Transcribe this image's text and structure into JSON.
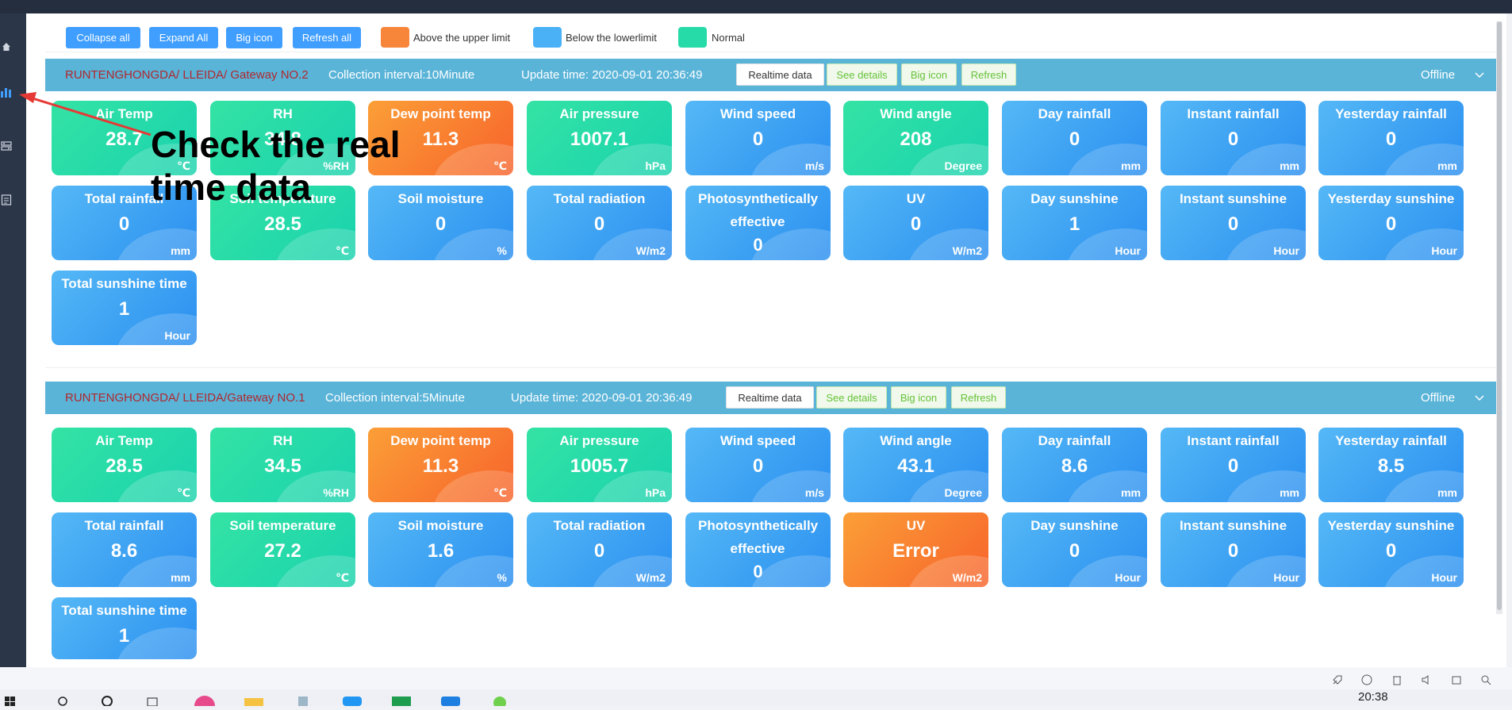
{
  "toolbar": {
    "collapse_all": "Collapse all",
    "expand_all": "Expand All",
    "big_icon": "Big icon",
    "refresh_all": "Refresh all",
    "legend": [
      {
        "label": "Above the upper limit",
        "color": "#f7853a"
      },
      {
        "label": "Below the lowerlimit",
        "color": "#4ab1f7"
      },
      {
        "label": "Normal",
        "color": "#26dba8"
      }
    ]
  },
  "gateways": [
    {
      "name": "RUNTENGHONGDA/ LLEIDA/ Gateway NO.2",
      "interval": "Collection interval:10Minute",
      "update": "Update time: 2020-09-01 20:36:49",
      "buttons": {
        "realtime": "Realtime data",
        "details": "See details",
        "big_icon": "Big icon",
        "refresh": "Refresh"
      },
      "status": "Offline",
      "cards": [
        {
          "title": "Air Temp",
          "value": "28.7",
          "unit": "℃",
          "color": "green"
        },
        {
          "title": "RH",
          "value": "34.8",
          "unit": "%RH",
          "color": "green"
        },
        {
          "title": "Dew point temp",
          "value": "11.3",
          "unit": "℃",
          "color": "orange"
        },
        {
          "title": "Air pressure",
          "value": "1007.1",
          "unit": "hPa",
          "color": "green"
        },
        {
          "title": "Wind speed",
          "value": "0",
          "unit": "m/s",
          "color": "blue"
        },
        {
          "title": "Wind angle",
          "value": "208",
          "unit": "Degree",
          "color": "green"
        },
        {
          "title": "Day rainfall",
          "value": "0",
          "unit": "mm",
          "color": "blue"
        },
        {
          "title": "Instant rainfall",
          "value": "0",
          "unit": "mm",
          "color": "blue"
        },
        {
          "title": "Yesterday rainfall",
          "value": "0",
          "unit": "mm",
          "color": "blue"
        },
        {
          "title": "Total rainfall",
          "value": "0",
          "unit": "mm",
          "color": "blue"
        },
        {
          "title": "Soil temperature",
          "value": "28.5",
          "unit": "℃",
          "color": "green"
        },
        {
          "title": "Soil moisture",
          "value": "0",
          "unit": "%",
          "color": "blue"
        },
        {
          "title": "Total radiation",
          "value": "0",
          "unit": "W/m2",
          "color": "blue"
        },
        {
          "title": "Photosynthetically effective",
          "value": "0",
          "unit": "",
          "color": "blue",
          "two_line": true
        },
        {
          "title": "UV",
          "value": "0",
          "unit": "W/m2",
          "color": "blue"
        },
        {
          "title": "Day sunshine",
          "value": "1",
          "unit": "Hour",
          "color": "blue"
        },
        {
          "title": "Instant sunshine",
          "value": "0",
          "unit": "Hour",
          "color": "blue"
        },
        {
          "title": "Yesterday sunshine",
          "value": "0",
          "unit": "Hour",
          "color": "blue"
        },
        {
          "title": "Total sunshine time",
          "value": "1",
          "unit": "Hour",
          "color": "blue"
        }
      ]
    },
    {
      "name": "RUNTENGHONGDA/ LLEIDA/Gateway NO.1",
      "interval": "Collection interval:5Minute",
      "update": "Update time: 2020-09-01 20:36:49",
      "buttons": {
        "realtime": "Realtime data",
        "details": "See details",
        "big_icon": "Big icon",
        "refresh": "Refresh"
      },
      "status": "Offline",
      "cards": [
        {
          "title": "Air Temp",
          "value": "28.5",
          "unit": "℃",
          "color": "green"
        },
        {
          "title": "RH",
          "value": "34.5",
          "unit": "%RH",
          "color": "green"
        },
        {
          "title": "Dew point temp",
          "value": "11.3",
          "unit": "℃",
          "color": "orange"
        },
        {
          "title": "Air pressure",
          "value": "1005.7",
          "unit": "hPa",
          "color": "green"
        },
        {
          "title": "Wind speed",
          "value": "0",
          "unit": "m/s",
          "color": "blue"
        },
        {
          "title": "Wind angle",
          "value": "43.1",
          "unit": "Degree",
          "color": "blue"
        },
        {
          "title": "Day rainfall",
          "value": "8.6",
          "unit": "mm",
          "color": "blue"
        },
        {
          "title": "Instant rainfall",
          "value": "0",
          "unit": "mm",
          "color": "blue"
        },
        {
          "title": "Yesterday rainfall",
          "value": "8.5",
          "unit": "mm",
          "color": "blue"
        },
        {
          "title": "Total rainfall",
          "value": "8.6",
          "unit": "mm",
          "color": "blue"
        },
        {
          "title": "Soil temperature",
          "value": "27.2",
          "unit": "℃",
          "color": "green"
        },
        {
          "title": "Soil moisture",
          "value": "1.6",
          "unit": "%",
          "color": "blue"
        },
        {
          "title": "Total radiation",
          "value": "0",
          "unit": "W/m2",
          "color": "blue"
        },
        {
          "title": "Photosynthetically effective",
          "value": "0",
          "unit": "",
          "color": "blue",
          "two_line": true
        },
        {
          "title": "UV",
          "value": "Error",
          "unit": "W/m2",
          "color": "orange"
        },
        {
          "title": "Day sunshine",
          "value": "0",
          "unit": "Hour",
          "color": "blue"
        },
        {
          "title": "Instant sunshine",
          "value": "0",
          "unit": "Hour",
          "color": "blue"
        },
        {
          "title": "Yesterday sunshine",
          "value": "0",
          "unit": "Hour",
          "color": "blue"
        },
        {
          "title": "Total sunshine time",
          "value": "1",
          "unit": "",
          "color": "blue"
        }
      ]
    }
  ],
  "annotation": {
    "text": "Check the real\ntime data"
  },
  "sidebar": {
    "icons": [
      "home-icon",
      "bar-chart-icon",
      "settings-panel-icon",
      "document-list-icon"
    ],
    "active_color": "#409eff"
  },
  "taskbar": {
    "clock": "20:38"
  }
}
